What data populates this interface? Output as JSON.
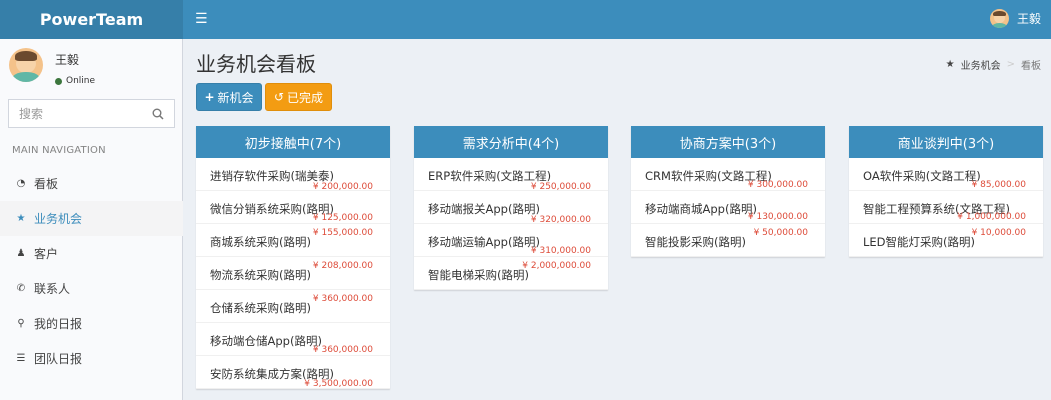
{
  "app": {
    "logo": "PowerTeam",
    "menu_icon": "bars-icon"
  },
  "user": {
    "name": "王毅",
    "status": "Online"
  },
  "search": {
    "placeholder": "搜索"
  },
  "nav": {
    "header": "MAIN NAVIGATION",
    "items": [
      {
        "label": "看板",
        "icon": "dashboard-icon",
        "glyph": "◔"
      },
      {
        "label": "业务机会",
        "icon": "star-icon",
        "glyph": "★"
      },
      {
        "label": "客户",
        "icon": "user-icon",
        "glyph": "♟"
      },
      {
        "label": "联系人",
        "icon": "phone-icon",
        "glyph": "✆"
      },
      {
        "label": "我的日报",
        "icon": "pin-icon",
        "glyph": "⚲"
      },
      {
        "label": "团队日报",
        "icon": "list-icon",
        "glyph": "☰"
      }
    ],
    "active_index": 1
  },
  "page": {
    "title": "业务机会看板"
  },
  "breadcrumb": {
    "home": "业务机会",
    "current": "看板"
  },
  "actions": {
    "new_label": "新机会",
    "done_label": "已完成"
  },
  "colors": {
    "primary": "#3c8dbc",
    "warning": "#f39c12",
    "price": "#dd4b39"
  },
  "board": [
    {
      "title": "初步接触中(7个)",
      "cards": [
        {
          "name": "进销存软件采购(瑞美泰)",
          "price": "¥ 200,000.00"
        },
        {
          "name": "微信分销系统采购(路明)",
          "price": "¥ 125,000.00"
        },
        {
          "name": "商城系统采购(路明)",
          "price": "¥ 155,000.00"
        },
        {
          "name": "物流系统采购(路明)",
          "price": "¥ 208,000.00"
        },
        {
          "name": "仓储系统采购(路明)",
          "price": "¥ 360,000.00"
        },
        {
          "name": "移动端仓储App(路明)",
          "price": "¥ 360,000.00"
        },
        {
          "name": "安防系统集成方案(路明)",
          "price": "¥ 3,500,000.00"
        }
      ]
    },
    {
      "title": "需求分析中(4个)",
      "cards": [
        {
          "name": "ERP软件采购(文路工程)",
          "price": "¥ 250,000.00"
        },
        {
          "name": "移动端报关App(路明)",
          "price": "¥ 320,000.00"
        },
        {
          "name": "移动端运输App(路明)",
          "price": "¥ 310,000.00"
        },
        {
          "name": "智能电梯采购(路明)",
          "price": "¥ 2,000,000.00"
        }
      ]
    },
    {
      "title": "协商方案中(3个)",
      "cards": [
        {
          "name": "CRM软件采购(文路工程)",
          "price": "¥ 300,000.00"
        },
        {
          "name": "移动端商城App(路明)",
          "price": "¥ 130,000.00"
        },
        {
          "name": "智能投影采购(路明)",
          "price": "¥ 50,000.00"
        }
      ]
    },
    {
      "title": "商业谈判中(3个)",
      "cards": [
        {
          "name": "OA软件采购(文路工程)",
          "price": "¥ 85,000.00"
        },
        {
          "name": "智能工程预算系统(文路工程)",
          "price": "¥ 1,000,000.00"
        },
        {
          "name": "LED智能灯采购(路明)",
          "price": "¥ 10,000.00"
        }
      ]
    }
  ]
}
